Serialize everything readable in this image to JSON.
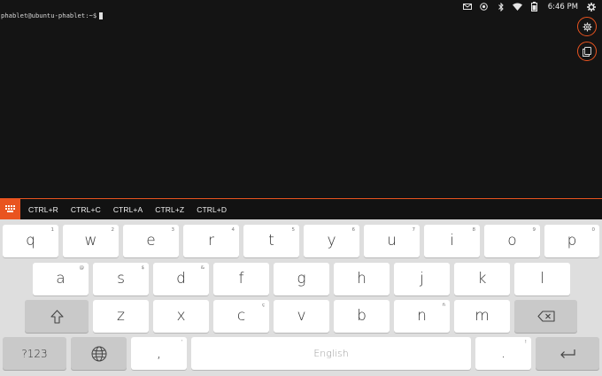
{
  "statusbar": {
    "icons": [
      "envelope-icon",
      "location-icon",
      "bluetooth-icon",
      "wifi-icon",
      "battery-icon"
    ],
    "time": "6:46 PM",
    "settings_icon": "gear-icon"
  },
  "terminal": {
    "prompt": "phablet@ubuntu-phablet:~$"
  },
  "side_buttons": [
    {
      "icon": "settings-icon"
    },
    {
      "icon": "copy-icon"
    }
  ],
  "shortcut_bar": {
    "toggle_icon": "keypad-icon",
    "items": [
      "CTRL+R",
      "CTRL+C",
      "CTRL+A",
      "CTRL+Z",
      "CTRL+D"
    ]
  },
  "keyboard": {
    "row1": [
      {
        "label": "q",
        "hint": "1"
      },
      {
        "label": "w",
        "hint": "2"
      },
      {
        "label": "e",
        "hint": "3"
      },
      {
        "label": "r",
        "hint": "4"
      },
      {
        "label": "t",
        "hint": "5"
      },
      {
        "label": "y",
        "hint": "6"
      },
      {
        "label": "u",
        "hint": "7"
      },
      {
        "label": "i",
        "hint": "8"
      },
      {
        "label": "o",
        "hint": "9"
      },
      {
        "label": "p",
        "hint": "0"
      }
    ],
    "row2": [
      {
        "label": "a",
        "hint": "@"
      },
      {
        "label": "s",
        "hint": "$"
      },
      {
        "label": "d",
        "hint": "&"
      },
      {
        "label": "f",
        "hint": ""
      },
      {
        "label": "g",
        "hint": ""
      },
      {
        "label": "h",
        "hint": ""
      },
      {
        "label": "j",
        "hint": ""
      },
      {
        "label": "k",
        "hint": ""
      },
      {
        "label": "l",
        "hint": ""
      }
    ],
    "row3": [
      {
        "label": "z",
        "hint": ""
      },
      {
        "label": "x",
        "hint": ""
      },
      {
        "label": "c",
        "hint": "ç"
      },
      {
        "label": "v",
        "hint": ""
      },
      {
        "label": "b",
        "hint": ""
      },
      {
        "label": "n",
        "hint": "ñ"
      },
      {
        "label": "m",
        "hint": ""
      }
    ],
    "symbols_label": "?123",
    "comma": {
      "label": ",",
      "hint": "'"
    },
    "space_label": "English",
    "period": {
      "label": ".",
      "hint": "!"
    },
    "shift_icon": "shift-arrow-icon",
    "backspace_icon": "backspace-icon",
    "language_icon": "globe-icon",
    "enter_icon": "enter-icon"
  }
}
